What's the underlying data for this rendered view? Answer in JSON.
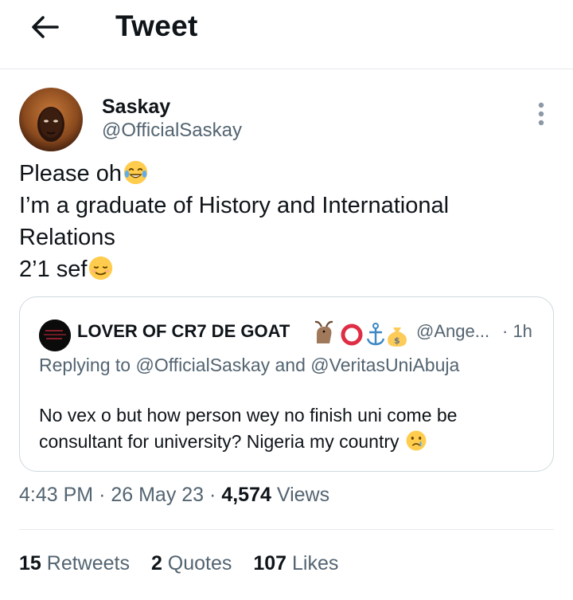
{
  "header": {
    "title": "Tweet",
    "back_icon": "arrow-left-icon"
  },
  "author": {
    "name": "Saskay",
    "handle": "@OfficialSaskay"
  },
  "tweet": {
    "lines": [
      "Please oh",
      "I’m a graduate of History and International",
      "Relations",
      "2’1 sef"
    ],
    "emojis": [
      "joy-emoji",
      "relieved-emoji"
    ]
  },
  "quote": {
    "name": "LOVER OF CR7 DE GOAT",
    "emojis": [
      "goat-emoji",
      "red-circle-emoji",
      "anchor-emoji",
      "money-bag-emoji"
    ],
    "handle": "@Ange...",
    "time": "· 1h",
    "replying_prefix": "Replying to",
    "reply_mention_1": "@OfficialSaskay",
    "reply_and": "and",
    "reply_mention_2": "@VeritasUniAbuja",
    "text": "No vex o but how person wey no finish uni come be consultant for university? Nigeria my country",
    "text_emoji": "crying-emoji"
  },
  "meta": {
    "time": "4:43 PM",
    "sep1": "·",
    "date": "26 May 23",
    "sep2": "·",
    "views_count": "4,574",
    "views_label": "Views"
  },
  "stats": {
    "retweets_count": "15",
    "retweets_label": "Retweets",
    "quotes_count": "2",
    "quotes_label": "Quotes",
    "likes_count": "107",
    "likes_label": "Likes"
  },
  "colors": {
    "text": "#0f1419",
    "secondary": "#536471",
    "border": "#cfd9de",
    "divider": "#e6e9ec"
  }
}
